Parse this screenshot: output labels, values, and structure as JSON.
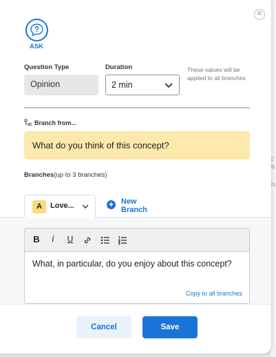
{
  "dialog": {
    "close_glyph": "✕",
    "ask_label": "ASK",
    "icons": [
      "close-icon",
      "question-bubble-icon",
      "branch-icon",
      "chevron-down-icon",
      "plus-icon"
    ]
  },
  "question_type": {
    "label": "Question Type",
    "value": "Opinion"
  },
  "duration": {
    "label": "Duration",
    "selected": "2 min"
  },
  "hint": "These values will be applied to all branches",
  "branch_from": {
    "label": "Branch from...",
    "question": "What do you think of this concept?"
  },
  "branches": {
    "label": "Branches",
    "sublabel": "(up to 3 branches)",
    "tabs": [
      {
        "badge": "A",
        "name": "Love..."
      }
    ],
    "new_branch_label_line1": "New",
    "new_branch_label_line2": "Branch",
    "new_branch_icon_glyph": "+"
  },
  "editor": {
    "toolbar": {
      "bold": "B",
      "italic": "i",
      "underline": "U"
    },
    "text": "What, in particular, do you enjoy about this concept?",
    "copy_link": "Copy to all branches"
  },
  "footer": {
    "cancel_label": "Cancel",
    "save_label": "Save"
  },
  "colors": {
    "accent": "#1a73d9",
    "highlight": "#fde9ac",
    "badge": "#fbd97a"
  }
}
